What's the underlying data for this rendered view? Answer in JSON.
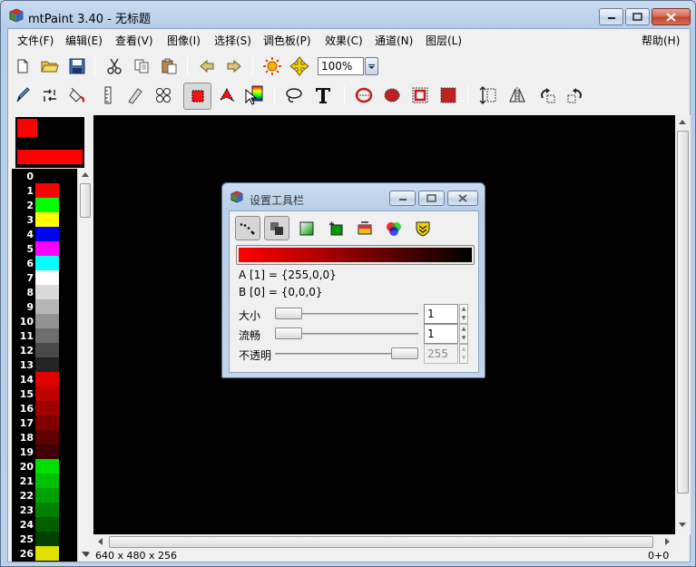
{
  "window": {
    "title": "mtPaint 3.40 - 无标题"
  },
  "menu": [
    {
      "label": "文件(F)"
    },
    {
      "label": "编辑(E)"
    },
    {
      "label": "查看(V)"
    },
    {
      "label": "图像(I)"
    },
    {
      "label": "选择(S)"
    },
    {
      "label": "调色板(P)"
    },
    {
      "label": "效果(C)"
    },
    {
      "label": "通道(N)"
    },
    {
      "label": "图层(L)"
    }
  ],
  "help_menu": "帮助(H)",
  "toolbar": {
    "zoom_value": "100%"
  },
  "colors": {
    "canvas": "#000000",
    "color_a": "#ff0000",
    "color_b": "#000000"
  },
  "palette": [
    {
      "index": "0",
      "color": "#000000"
    },
    {
      "index": "1",
      "color": "#ff0000"
    },
    {
      "index": "2",
      "color": "#00ff00"
    },
    {
      "index": "3",
      "color": "#ffff00"
    },
    {
      "index": "4",
      "color": "#0000ff"
    },
    {
      "index": "5",
      "color": "#ff00ff"
    },
    {
      "index": "6",
      "color": "#00ffff"
    },
    {
      "index": "7",
      "color": "#ffffff"
    },
    {
      "index": "8",
      "color": "#dadada"
    },
    {
      "index": "9",
      "color": "#b6b6b6"
    },
    {
      "index": "10",
      "color": "#929292"
    },
    {
      "index": "11",
      "color": "#6d6d6d"
    },
    {
      "index": "12",
      "color": "#494949"
    },
    {
      "index": "13",
      "color": "#242424"
    },
    {
      "index": "14",
      "color": "#e00000"
    },
    {
      "index": "15",
      "color": "#c00000"
    },
    {
      "index": "16",
      "color": "#a00000"
    },
    {
      "index": "17",
      "color": "#800000"
    },
    {
      "index": "18",
      "color": "#600000"
    },
    {
      "index": "19",
      "color": "#400000"
    },
    {
      "index": "20",
      "color": "#00e000"
    },
    {
      "index": "21",
      "color": "#00c000"
    },
    {
      "index": "22",
      "color": "#00a000"
    },
    {
      "index": "23",
      "color": "#008000"
    },
    {
      "index": "24",
      "color": "#006000"
    },
    {
      "index": "25",
      "color": "#004000"
    },
    {
      "index": "26",
      "color": "#e0e000"
    }
  ],
  "status": {
    "image_info": "640 x 480 x 256",
    "coords": "0+0"
  },
  "dialog": {
    "title": "设置工具栏",
    "color_a_text": "A [1] = {255,0,0}",
    "color_b_text": "B [0] = {0,0,0}",
    "size_label": "大小",
    "size_value": "1",
    "flow_label": "流畅",
    "flow_value": "1",
    "opacity_label": "不透明",
    "opacity_value": "255",
    "size_level": 1,
    "flow_level": 1,
    "opacity_level": 255
  }
}
